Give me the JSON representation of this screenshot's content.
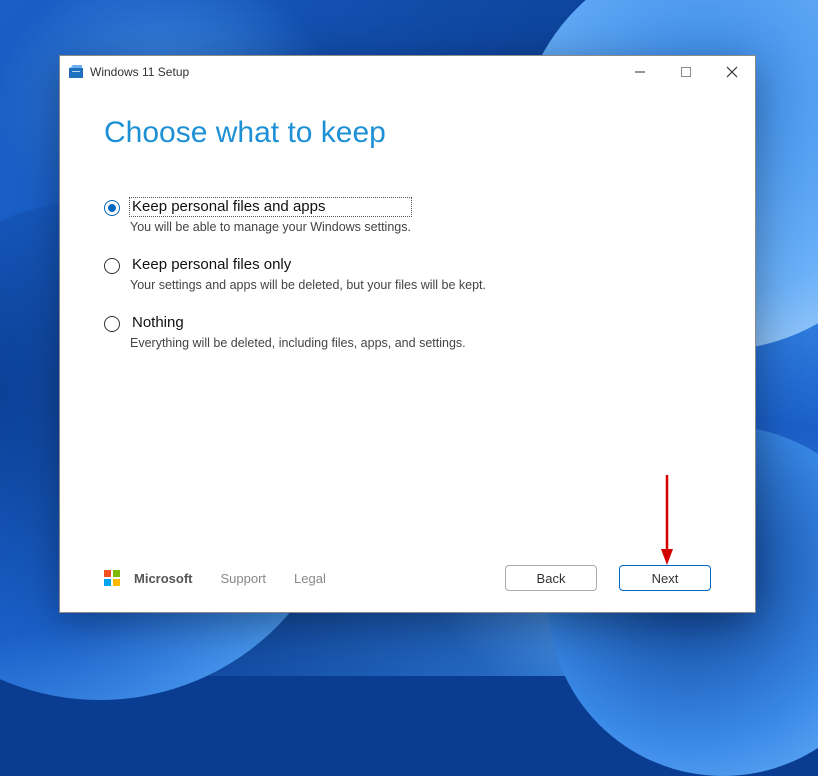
{
  "titlebar": {
    "title": "Windows 11 Setup"
  },
  "heading": "Choose what to keep",
  "options": [
    {
      "selected": true,
      "label": "Keep personal files and apps",
      "description": "You will be able to manage your Windows settings."
    },
    {
      "selected": false,
      "label": "Keep personal files only",
      "description": "Your settings and apps will be deleted, but your files will be kept."
    },
    {
      "selected": false,
      "label": "Nothing",
      "description": "Everything will be deleted, including files, apps, and settings."
    }
  ],
  "footer": {
    "brand": "Microsoft",
    "support": "Support",
    "legal": "Legal",
    "back": "Back",
    "next": "Next"
  }
}
